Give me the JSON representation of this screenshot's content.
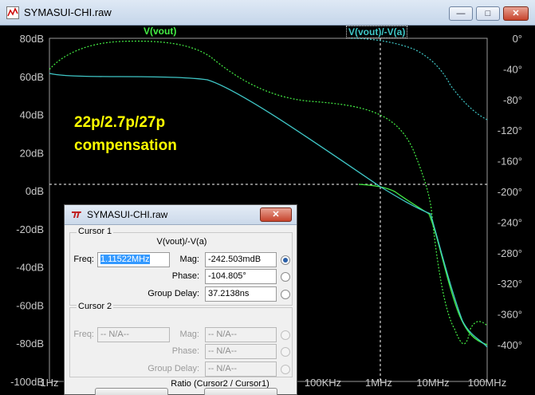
{
  "window": {
    "title": "SYMASUI-CHI.raw",
    "buttons": {
      "minimize": "—",
      "maximize": "□",
      "close": "✕"
    }
  },
  "plot": {
    "left_axis_ticks": [
      "80dB",
      "60dB",
      "40dB",
      "20dB",
      "0dB",
      "-20dB",
      "-40dB",
      "-60dB",
      "-80dB",
      "-100dB"
    ],
    "right_axis_ticks": [
      "0°",
      "-40°",
      "-80°",
      "-120°",
      "-160°",
      "-200°",
      "-240°",
      "-280°",
      "-320°",
      "-360°",
      "-400°"
    ],
    "x_axis_ticks": [
      "1Hz",
      "100KHz",
      "1MHz",
      "10MHz",
      "100MHz"
    ],
    "traces": [
      {
        "name": "V(vout)",
        "color": "#44ee44"
      },
      {
        "name": "V(vout)/-V(a)",
        "color": "#3fc6c6"
      }
    ],
    "annotation_lines": [
      "22p/2.7p/27p",
      "compensation"
    ],
    "annotation_color": "#ffff00"
  },
  "dialog": {
    "title": "SYMASUI-CHI.raw",
    "close": "✕",
    "cursor1": {
      "group_label": "Cursor 1",
      "expression": "V(vout)/-V(a)",
      "freq_label": "Freq:",
      "freq_value": "1.11522MHz",
      "mag_label": "Mag:",
      "mag_value": "-242.503mdB",
      "phase_label": "Phase:",
      "phase_value": "-104.805°",
      "delay_label": "Group Delay:",
      "delay_value": "37.2138ns"
    },
    "cursor2": {
      "group_label": "Cursor 2",
      "freq_label": "Freq:",
      "freq_value": "-- N/A--",
      "mag_label": "Mag:",
      "mag_value": "-- N/A--",
      "phase_label": "Phase:",
      "phase_value": "-- N/A--",
      "delay_label": "Group Delay:",
      "delay_value": "-- N/A--"
    },
    "ratio_label": "Ratio (Cursor2 / Cursor1)"
  }
}
